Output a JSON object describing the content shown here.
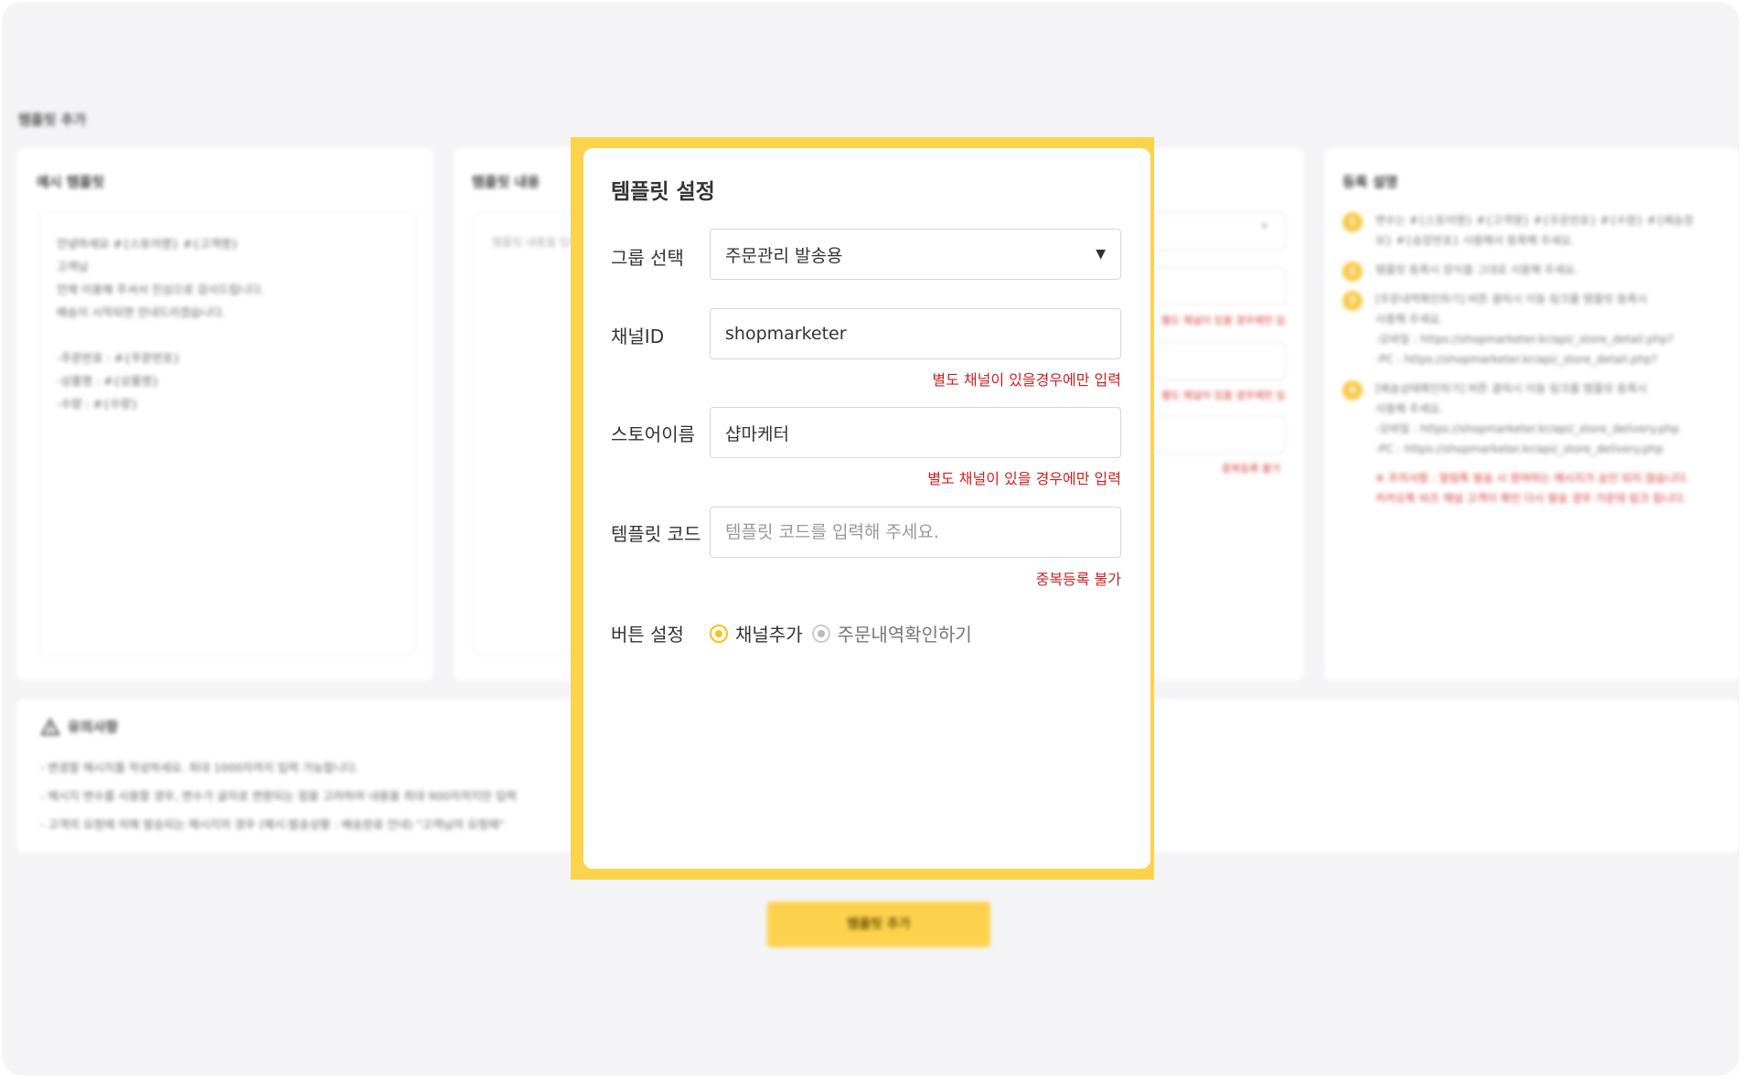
{
  "background": {
    "section_title": "템플릿 추가",
    "example_card": {
      "title": "예시 템플릿",
      "lines": "안녕하세요 #{스토어명} #{고객명}\n고객님\n언제 이용해 주셔서 진심으로 감사드립니다.\n배송이 시작되면 안내드리겠습니다.\n\n-주문번호 : #{주문번호}\n-상품명 : #{상품명}\n-수량 : #{수량}"
    },
    "content_card": {
      "title": "템플릿 내용",
      "placeholder": "템플릿 내용을 입력"
    },
    "guide_card": {
      "title": "등록 설명",
      "items": [
        {
          "num": "1",
          "text": "변수는 #{스토어명} #{고객명} #{주문번호} #{수량} #{배송정\n보} #{송장번호} 사용해서 등록해 주세요."
        },
        {
          "num": "2",
          "text": "템플릿 등록시 양식을 그대로 사용해 주세요."
        },
        {
          "num": "3",
          "text": "[주문내역확인하기] 버튼 클릭시 이동 링크를 템플릿 등록시\n사용해 주세요.\n-모바일 : https://shopmarketer.kr/api/_store_detail.php?\n-PC : https://shopmarketer.kr/api/_store_detail.php?"
        },
        {
          "num": "4",
          "text": "[배송상태확인하기] 버튼 클릭시 이동 링크를 템플릿 등록시\n사용해 주세요.\n-모바일 : https://shopmarketer.kr/api/_store_delivery.php\n-PC : https://shopmarketer.kr/api/_store_delivery.php"
        }
      ],
      "warning": "※ 주의사항 : 알림톡 발송 시 참여하는 메시지가 승인 되지 않습니다.\n카카오톡 비즈 채널 고객이 확인 다시 발송 경우 가운데 링크 됩니다."
    },
    "notice": {
      "title": "유의사항",
      "lines": "- 변경할 메시지를 작성하세요. 최대 1000자까지 입력 가능합니다.\n- 메시지 변수를 사용할 경우, 변수가 글자로 변환되는 점을 고려하여 내용을 최대 900자까지만 입력\n- 고객의 요청에 의해 발송되는 메시지의 경우 (예시:발송상황 : 배송완료 안내) \"고객님의 요청에\""
    },
    "side_hints": [
      "별도 채널이 있을 경우에만 입력",
      "별도 채널이 있을 경우에만 입력",
      "중복등록 불가"
    ],
    "submit_label": "템플릿 추가"
  },
  "panel": {
    "title": "템플릿 설정",
    "group": {
      "label": "그룹 선택",
      "value": "주문관리 발송용"
    },
    "channel": {
      "label": "채널ID",
      "value": "shopmarketer",
      "hint": "별도 채널이 있을경우에만 입력"
    },
    "store": {
      "label": "스토어이름",
      "value": "샵마케터",
      "hint": "별도 채널이 있을 경우에만 입력"
    },
    "template_code": {
      "label": "템플릿 코드",
      "placeholder": "템플릿 코드를 입력해 주세요.",
      "hint": "중복등록 불가"
    },
    "button_setting": {
      "label": "버튼 설정",
      "options": [
        {
          "label": "채널추가",
          "selected": true
        },
        {
          "label": "주문내역확인하기",
          "selected": false
        }
      ]
    }
  },
  "colors": {
    "accent": "#fcd34d",
    "hint_red": "#d01f1f"
  },
  "icons": {
    "select_caret": "caret-down-icon",
    "notice": "warning-triangle-icon"
  }
}
